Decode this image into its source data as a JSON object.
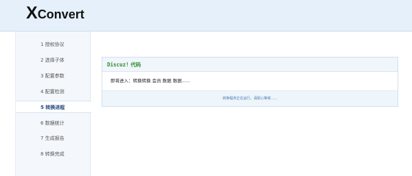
{
  "header": {
    "logo_initial": "X",
    "logo_rest": "Convert"
  },
  "sidebar": {
    "items": [
      {
        "label": "1 授权协议",
        "active": false
      },
      {
        "label": "2 选择子体",
        "active": false
      },
      {
        "label": "3 配置参数",
        "active": false
      },
      {
        "label": "4 配置检测",
        "active": false
      },
      {
        "label": "5 转换进程",
        "active": true
      },
      {
        "label": "6 数据统计",
        "active": false
      },
      {
        "label": "7 生成报告",
        "active": false
      },
      {
        "label": "8 转换完成",
        "active": false
      }
    ]
  },
  "panel": {
    "title_mono": "Discuz!",
    "title_cn": " 代码",
    "message": "即将进入：转换转换 会员 数据 数据......",
    "footer": "转换程序正在运行，请耐心等候......"
  },
  "colors": {
    "header_bg": "#e6f0fa",
    "sidebar_bg": "#f4f8fc",
    "panel_title": "#2a8a2a",
    "footer_text": "#4a7ab0"
  }
}
